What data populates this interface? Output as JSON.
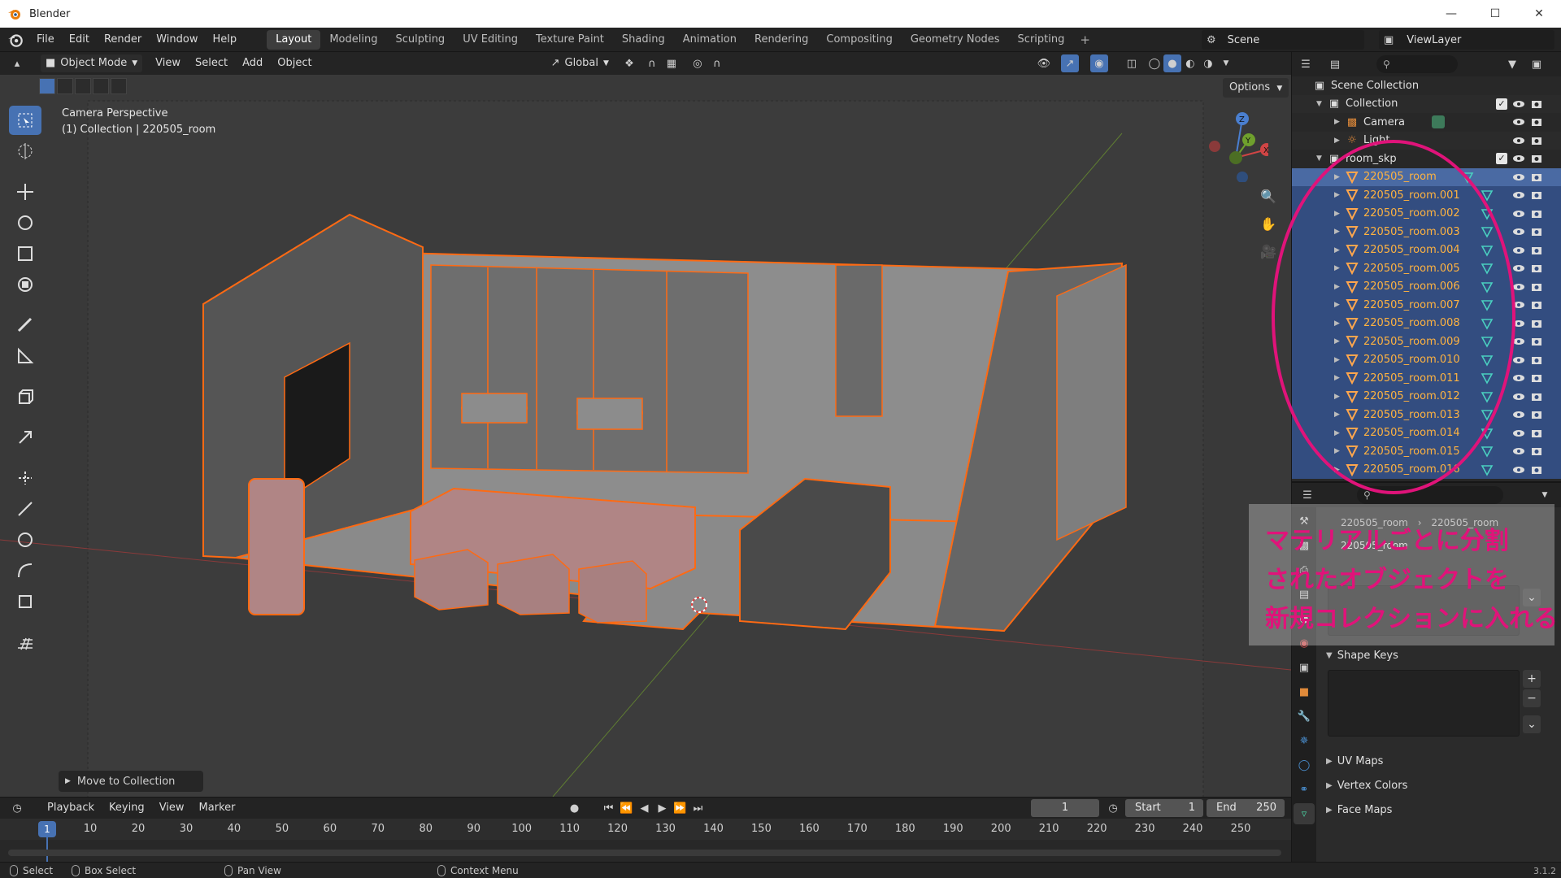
{
  "window": {
    "title": "Blender",
    "controls": [
      "minimize-icon",
      "maximize-icon",
      "close-icon"
    ]
  },
  "menu": {
    "items": [
      "File",
      "Edit",
      "Render",
      "Window",
      "Help"
    ]
  },
  "workspaces": {
    "tabs": [
      "Layout",
      "Modeling",
      "Sculpting",
      "UV Editing",
      "Texture Paint",
      "Shading",
      "Animation",
      "Rendering",
      "Compositing",
      "Geometry Nodes",
      "Scripting"
    ],
    "active": "Layout",
    "add_label": "+"
  },
  "scene": {
    "name": "Scene"
  },
  "view_layer": {
    "name": "ViewLayer"
  },
  "viewport": {
    "mode": "Object Mode",
    "menus": [
      "View",
      "Select",
      "Add",
      "Object"
    ],
    "orientation": "Global",
    "options_label": "Options",
    "info_line1": "Camera Perspective",
    "info_line2": "(1) Collection | 220505_room",
    "last_op_label": "Move to Collection",
    "gizmo_axes": [
      "Z",
      "Y",
      "X"
    ]
  },
  "outliner": {
    "scene_collection": "Scene Collection",
    "collection": "Collection",
    "camera": "Camera",
    "light": "Light",
    "new_collection": "room_skp",
    "objects": [
      "220505_room",
      "220505_room.001",
      "220505_room.002",
      "220505_room.003",
      "220505_room.004",
      "220505_room.005",
      "220505_room.006",
      "220505_room.007",
      "220505_room.008",
      "220505_room.009",
      "220505_room.010",
      "220505_room.011",
      "220505_room.012",
      "220505_room.013",
      "220505_room.014",
      "220505_room.015",
      "220505_room.016"
    ]
  },
  "properties": {
    "breadcrumb_object": "220505_room",
    "breadcrumb_mesh": "220505_room",
    "data_name": "220505_room",
    "sections": {
      "shape_keys": "Shape Keys",
      "uv_maps": "UV Maps",
      "vertex_colors": "Vertex Colors",
      "face_maps": "Face Maps"
    },
    "add_label": "+",
    "remove_label": "−"
  },
  "timeline": {
    "menus": [
      "Playback",
      "Keying",
      "View",
      "Marker"
    ],
    "current_frame": "1",
    "start_label": "Start",
    "start_value": "1",
    "end_label": "End",
    "end_value": "250",
    "ticks": [
      "1",
      "10",
      "20",
      "30",
      "40",
      "50",
      "60",
      "70",
      "80",
      "90",
      "100",
      "110",
      "120",
      "130",
      "140",
      "150",
      "160",
      "170",
      "180",
      "190",
      "200",
      "210",
      "220",
      "230",
      "240",
      "250"
    ]
  },
  "statusbar": {
    "select": "Select",
    "box_select": "Box Select",
    "pan_view": "Pan View",
    "context_menu": "Context Menu",
    "version": "3.1.2"
  },
  "annotation": {
    "line1": "マテリアルごとに分割",
    "line2": "されたオブジェクトを",
    "line3": "新規コレクションに入れる",
    "color": "#e0137a"
  },
  "colors": {
    "accent": "#4772b3",
    "selection_outline": "#ff6a13",
    "selected_row": "#334d80",
    "object_text": "#ffa64d"
  }
}
